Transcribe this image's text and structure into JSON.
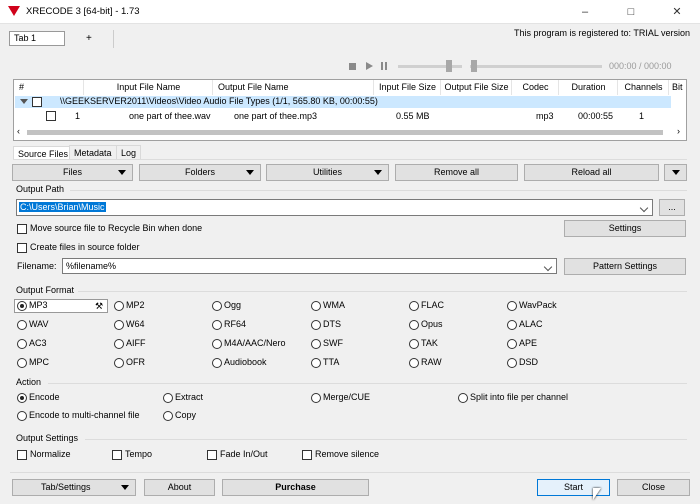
{
  "title": "XRECODE 3 [64-bit] - 1.73",
  "tabs": [
    "Tab 1",
    "+"
  ],
  "registered": "This program is registered to: TRIAL version",
  "time": "000:00 / 000:00",
  "columns": [
    "#",
    "Input File Name",
    "Output File Name",
    "Input File Size",
    "Output File Size",
    "Codec",
    "Duration",
    "Channels",
    "Bit"
  ],
  "group_row": "\\\\GEEKSERVER2011\\Videos\\Video Audio File Types (1/1, 565.80 KB, 00:00:55)",
  "file_row": {
    "num": "1",
    "input": "one part of thee.wav",
    "output": "one part of thee.mp3",
    "insize": "0.55 MB",
    "codec": "mp3",
    "duration": "00:00:55",
    "channels": "1"
  },
  "lower_tabs": [
    "Source Files",
    "Metadata",
    "Log"
  ],
  "toolbar": {
    "files": "Files",
    "folders": "Folders",
    "utilities": "Utilities",
    "remove_all": "Remove all",
    "reload_all": "Reload all"
  },
  "output_path": {
    "label": "Output Path",
    "value": "C:\\Users\\Brian\\Music",
    "browse": "...",
    "move_recycle": "Move source file to Recycle Bin when done",
    "create_source": "Create files in source folder",
    "settings": "Settings",
    "filename_label": "Filename:",
    "filename_value": "%filename%",
    "pattern_settings": "Pattern Settings"
  },
  "output_format": {
    "label": "Output Format",
    "formats": [
      [
        "MP3",
        "MP2",
        "Ogg",
        "WMA",
        "FLAC",
        "WavPack"
      ],
      [
        "WAV",
        "W64",
        "RF64",
        "DTS",
        "Opus",
        "ALAC"
      ],
      [
        "AC3",
        "AIFF",
        "M4A/AAC/Nero",
        "SWF",
        "TAK",
        "APE"
      ],
      [
        "MPC",
        "OFR",
        "Audiobook",
        "TTA",
        "RAW",
        "DSD"
      ]
    ]
  },
  "action": {
    "label": "Action",
    "encode": "Encode",
    "extract": "Extract",
    "merge": "Merge/CUE",
    "split": "Split into file per channel",
    "multichannel": "Encode to multi-channel file",
    "copy": "Copy"
  },
  "output_settings": {
    "label": "Output Settings",
    "normalize": "Normalize",
    "tempo": "Tempo",
    "fade": "Fade In/Out",
    "silence": "Remove silence"
  },
  "bottom": {
    "tab_settings": "Tab/Settings",
    "about": "About",
    "purchase": "Purchase",
    "start": "Start",
    "close": "Close"
  },
  "colors": {
    "selection": "#0078d7",
    "group_row_bg": "#cce8ff",
    "accent": "#0078d7"
  }
}
